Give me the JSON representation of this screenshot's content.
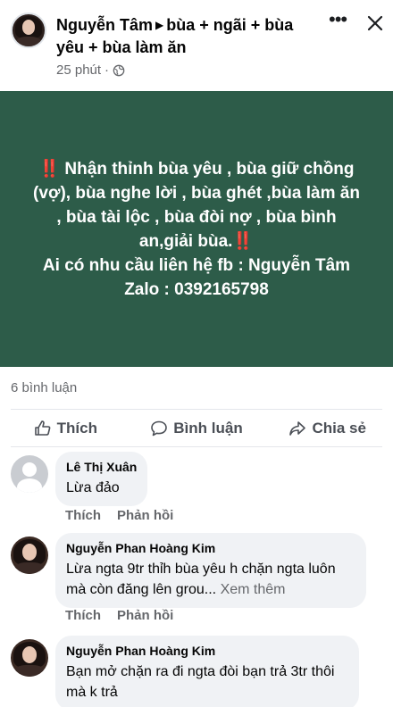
{
  "header": {
    "author": "Nguyễn Tâm",
    "arrow": "▶",
    "group": "bùa + ngãi + bùa yêu + bùa làm ăn",
    "time": "25 phút",
    "separator": "·"
  },
  "post": {
    "text_line1": "‼️ Nhận thỉnh bùa yêu , bùa giữ chồng (vợ), bùa nghe lời , bùa ghét ,bùa làm ăn , bùa tài lộc , bùa đòi nợ , bùa bình an,giải bùa.‼️",
    "text_line2": "Ai có nhu cầu liên hệ fb : Nguyễn Tâm",
    "text_line3": "Zalo : 0392165798",
    "background_color": "#2d5c49"
  },
  "stats": {
    "comments": "6 bình luận"
  },
  "actions": {
    "like": "Thích",
    "comment": "Bình luận",
    "share": "Chia sẻ"
  },
  "comments": [
    {
      "name": "Lê Thị Xuân",
      "text": "Lừa đảo",
      "like": "Thích",
      "reply": "Phản hồi"
    },
    {
      "name": "Nguyễn Phan Hoàng Kim",
      "text": "Lừa ngta 9tr thỉh bùa yêu h chặn ngta luôn mà còn đăng lên grou...",
      "see_more": "Xem thêm",
      "like": "Thích",
      "reply": "Phản hồi"
    },
    {
      "name": "Nguyễn Phan Hoàng Kim",
      "text": "Bạn mở chặn ra đi ngta đòi bạn trả 3tr thôi mà k trả"
    }
  ],
  "icons": {
    "globe": "globe-icon",
    "more": "more-icon",
    "close": "close-icon",
    "like": "thumbs-up-icon",
    "comment": "comment-icon",
    "share": "share-icon"
  }
}
